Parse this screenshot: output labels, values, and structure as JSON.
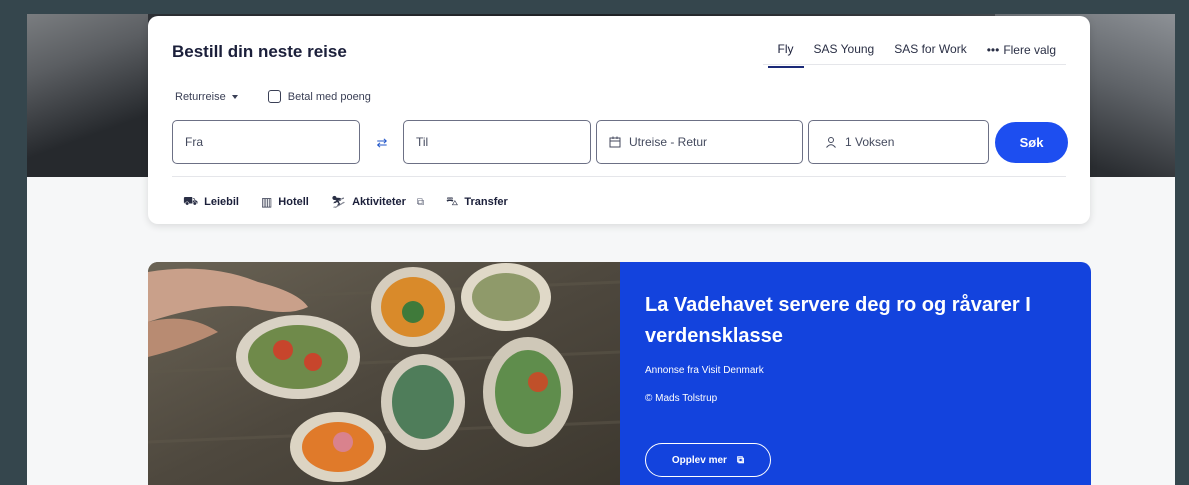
{
  "booking": {
    "title": "Bestill din neste reise",
    "tabs": [
      {
        "label": "Fly",
        "active": true
      },
      {
        "label": "SAS Young",
        "active": false
      },
      {
        "label": "SAS for Work",
        "active": false
      },
      {
        "label": "Flere valg",
        "active": false
      }
    ],
    "trip_type": "Returreise",
    "points_label": "Betal med poeng",
    "from_placeholder": "Fra",
    "to_placeholder": "Til",
    "dates_placeholder": "Utreise - Retur",
    "passengers": "1 Voksen",
    "search_label": "Søk",
    "extras": [
      {
        "label": "Leiebil",
        "icon": "car-icon"
      },
      {
        "label": "Hotell",
        "icon": "hotel-icon"
      },
      {
        "label": "Aktiviteter",
        "icon": "activity-icon"
      },
      {
        "label": "Transfer",
        "icon": "bus-icon"
      }
    ]
  },
  "ad": {
    "heading": "La Vadehavet servere deg ro og råvarer I verdensklasse",
    "sponsor": "Annonse fra Visit Denmark",
    "credit": "© Mads Tolstrup",
    "cta": "Opplev mer"
  },
  "colors": {
    "accent": "#1d4ef0",
    "ad_panel": "#1343dd",
    "title": "#1b1f3a"
  }
}
